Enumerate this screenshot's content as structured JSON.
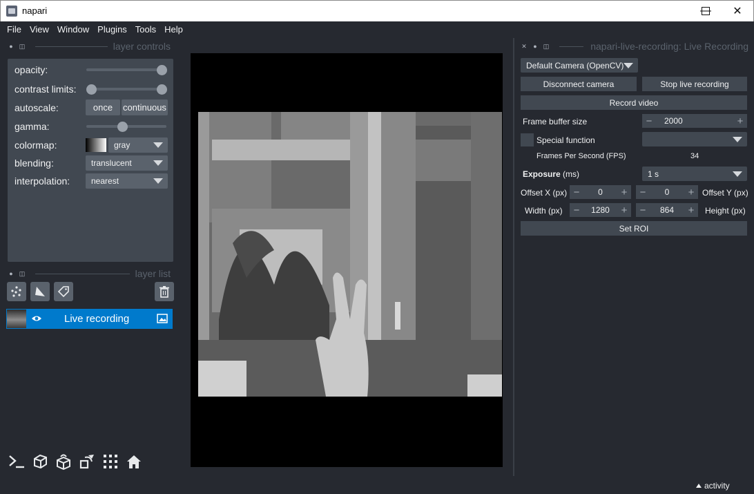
{
  "window": {
    "title": "napari"
  },
  "menu": [
    "File",
    "View",
    "Window",
    "Plugins",
    "Tools",
    "Help"
  ],
  "layer_controls": {
    "header": "layer controls",
    "opacity_label": "opacity:",
    "opacity_value": 1.0,
    "contrast_label": "contrast limits:",
    "autoscale_label": "autoscale:",
    "autoscale_once": "once",
    "autoscale_continuous": "continuous",
    "gamma_label": "gamma:",
    "gamma_value": 0.45,
    "colormap_label": "colormap:",
    "colormap_value": "gray",
    "blending_label": "blending:",
    "blending_value": "translucent",
    "interpolation_label": "interpolation:",
    "interpolation_value": "nearest"
  },
  "layer_list": {
    "header": "layer list",
    "layers": [
      {
        "name": "Live recording",
        "visible": true
      }
    ]
  },
  "plugin": {
    "header": "napari-live-recording: Live Recording",
    "camera_select": "Default Camera (OpenCV)",
    "disconnect_label": "Disconnect camera",
    "stop_label": "Stop live recording",
    "record_label": "Record video",
    "frame_buffer_label": "Frame buffer size",
    "frame_buffer_value": "2000",
    "special_function_label": "Special function",
    "special_function_value": "",
    "fps_label": "Frames Per Second (FPS)",
    "fps_value": "34",
    "exposure_label_bold": "Exposure",
    "exposure_label_unit": " (ms)",
    "exposure_value": "1 s",
    "offset_x_label": "Offset X (px)",
    "offset_x_value": "0",
    "offset_y_label": "Offset Y (px)",
    "offset_y_value": "0",
    "width_label": "Width (px)",
    "width_value": "1280",
    "height_label": "Height (px)",
    "height_value": "864",
    "set_roi_label": "Set ROI"
  },
  "status": {
    "activity_label": "activity"
  },
  "icons": {
    "console": "console-icon",
    "ndisplay": "cube-3d-icon",
    "roll": "roll-dims-icon",
    "transpose": "transpose-icon",
    "grid": "grid-icon",
    "home": "home-icon"
  }
}
